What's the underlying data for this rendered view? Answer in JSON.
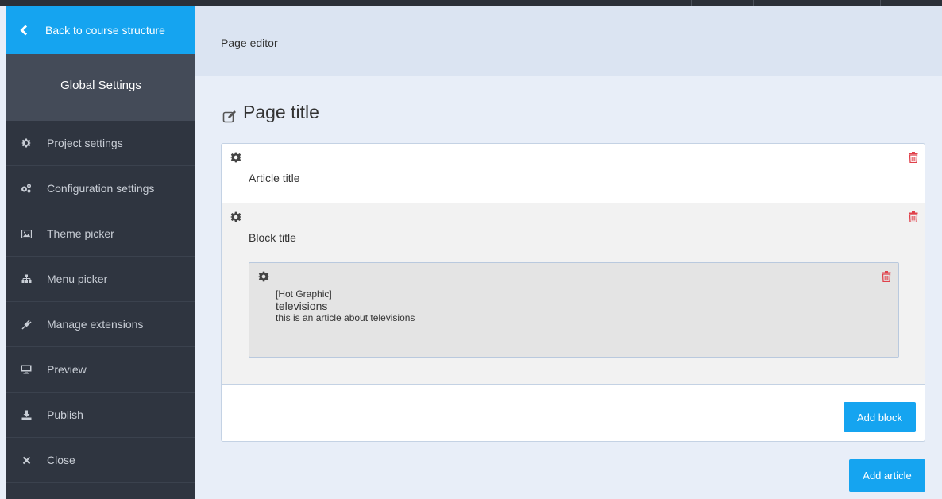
{
  "sidebar": {
    "back_label": "Back to course structure",
    "global_settings": "Global Settings",
    "items": [
      {
        "label": "Project settings",
        "icon": "gear-icon"
      },
      {
        "label": "Configuration settings",
        "icon": "gears-icon"
      },
      {
        "label": "Theme picker",
        "icon": "picture-icon"
      },
      {
        "label": "Menu picker",
        "icon": "sitemap-icon"
      },
      {
        "label": "Manage extensions",
        "icon": "plug-icon"
      },
      {
        "label": "Preview",
        "icon": "monitor-icon"
      },
      {
        "label": "Publish",
        "icon": "download-icon"
      },
      {
        "label": "Close",
        "icon": "close-icon"
      }
    ]
  },
  "header": {
    "title": "Page editor"
  },
  "page": {
    "title": "Page title",
    "article": {
      "title": "Article title",
      "block": {
        "title": "Block title",
        "component": {
          "type": "[Hot Graphic]",
          "title": "televisions",
          "body": "this is an article about televisions"
        },
        "add_block_label": "Add block"
      }
    },
    "add_article_label": "Add article"
  },
  "colors": {
    "accent": "#15a4f0",
    "sidebar_bg": "#2f3540",
    "global_bg": "#444b58",
    "header_bg": "#dbe4f2",
    "trash": "#e0414b"
  }
}
